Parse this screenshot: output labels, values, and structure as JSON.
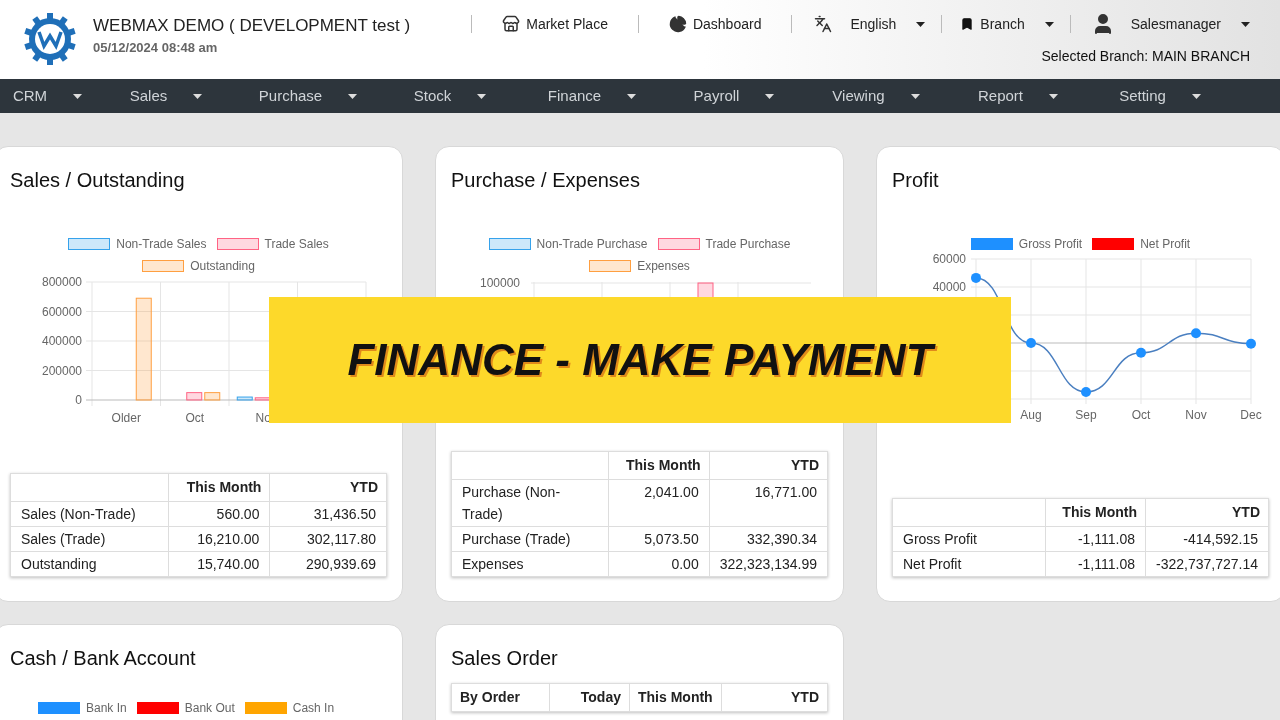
{
  "header": {
    "title": "WEBMAX DEMO ( DEVELOPMENT test )",
    "datetime": "05/12/2024 08:48 am",
    "links": [
      {
        "kind": "store",
        "label": "Market Place",
        "dropdown": false
      },
      {
        "kind": "chart",
        "label": "Dashboard",
        "dropdown": false
      },
      {
        "kind": "language",
        "label": "English",
        "dropdown": true
      },
      {
        "kind": "bookmark",
        "label": "Branch",
        "dropdown": true
      },
      {
        "kind": "user",
        "label": "Salesmanager",
        "dropdown": true
      }
    ],
    "selected_branch": "Selected Branch: MAIN BRANCH"
  },
  "menu": [
    "CRM",
    "Sales",
    "Purchase",
    "Stock",
    "Finance",
    "Payroll",
    "Viewing",
    "Report",
    "Setting"
  ],
  "cards": [
    {
      "title": "Sales / Outstanding",
      "kind": "chart",
      "chart_data": {
        "type": "bar",
        "categories": [
          "Older",
          "Oct",
          "No"
        ],
        "ylim": [
          0,
          800000
        ],
        "yticks": [
          0,
          200000,
          400000,
          600000,
          800000
        ],
        "grid": true,
        "series": [
          {
            "name": "Non-Trade Sales",
            "color": "#36a2eb",
            "values": [
              0,
              0,
              20000
            ]
          },
          {
            "name": "Trade Sales",
            "color": "#ff6384",
            "values": [
              0,
              50000,
              15000
            ]
          },
          {
            "name": "Outstanding",
            "color": "#ff9f40",
            "values": [
              690000,
              50000,
              null
            ]
          }
        ]
      },
      "table": {
        "columns": [
          "",
          "This Month",
          "YTD"
        ],
        "rows": [
          [
            "Sales (Non-Trade)",
            "560.00",
            "31,436.50"
          ],
          [
            "Sales (Trade)",
            "16,210.00",
            "302,117.80"
          ],
          [
            "Outstanding",
            "15,740.00",
            "290,939.69"
          ]
        ]
      }
    },
    {
      "title": "Purchase / Expenses",
      "kind": "chart_picture",
      "legend": [
        {
          "name": "Non-Trade Purchase",
          "color": "#36a2eb"
        },
        {
          "name": "Trade Purchase",
          "color": "#ff6384"
        },
        {
          "name": "Expenses",
          "color": "#ff9f40"
        }
      ],
      "tick_label": "100000",
      "table": {
        "columns": [
          "",
          "This Month",
          "YTD"
        ],
        "rows": [
          [
            "Purchase (Non-Trade)",
            "2,041.00",
            "16,771.00"
          ],
          [
            "Purchase (Trade)",
            "5,073.50",
            "332,390.34"
          ],
          [
            "Expenses",
            "0.00",
            "322,323,134.99"
          ]
        ]
      }
    },
    {
      "title": "Profit",
      "kind": "chart",
      "chart_data": {
        "type": "line",
        "categories": [
          null,
          "Aug",
          "Sep",
          "Oct",
          "Nov",
          "Dec"
        ],
        "ylim": [
          -40000,
          60000
        ],
        "yticks": [
          40000,
          60000
        ],
        "grid": true,
        "series": [
          {
            "name": "Gross Profit",
            "color": "#1e90ff",
            "marker": true,
            "values": [
              46500,
              0,
              -35000,
              -7000,
              7000,
              -500
            ]
          },
          {
            "name": "Net Profit",
            "color": "#ff0000",
            "values": [
              null,
              null,
              null,
              null,
              null,
              null
            ]
          }
        ]
      },
      "table": {
        "columns": [
          "",
          "This Month",
          "YTD"
        ],
        "rows": [
          [
            "Gross Profit",
            "-1,111.08",
            "-414,592.15"
          ],
          [
            "Net Profit",
            "-1,111.08",
            "-322,737,727.14"
          ]
        ]
      }
    },
    {
      "title": "Cash / Bank Account",
      "kind": "legend",
      "legend": [
        {
          "name": "Bank In",
          "color": "#1e90ff"
        },
        {
          "name": "Bank Out",
          "color": "#ff0000"
        },
        {
          "name": "Cash In",
          "color": "#ffa500"
        }
      ]
    },
    {
      "title": "Sales Order",
      "kind": "table",
      "table": {
        "columns": [
          "By Order",
          "Today",
          "This Month",
          "YTD"
        ]
      }
    }
  ],
  "banner": "FINANCE - MAKE PAYMENT"
}
